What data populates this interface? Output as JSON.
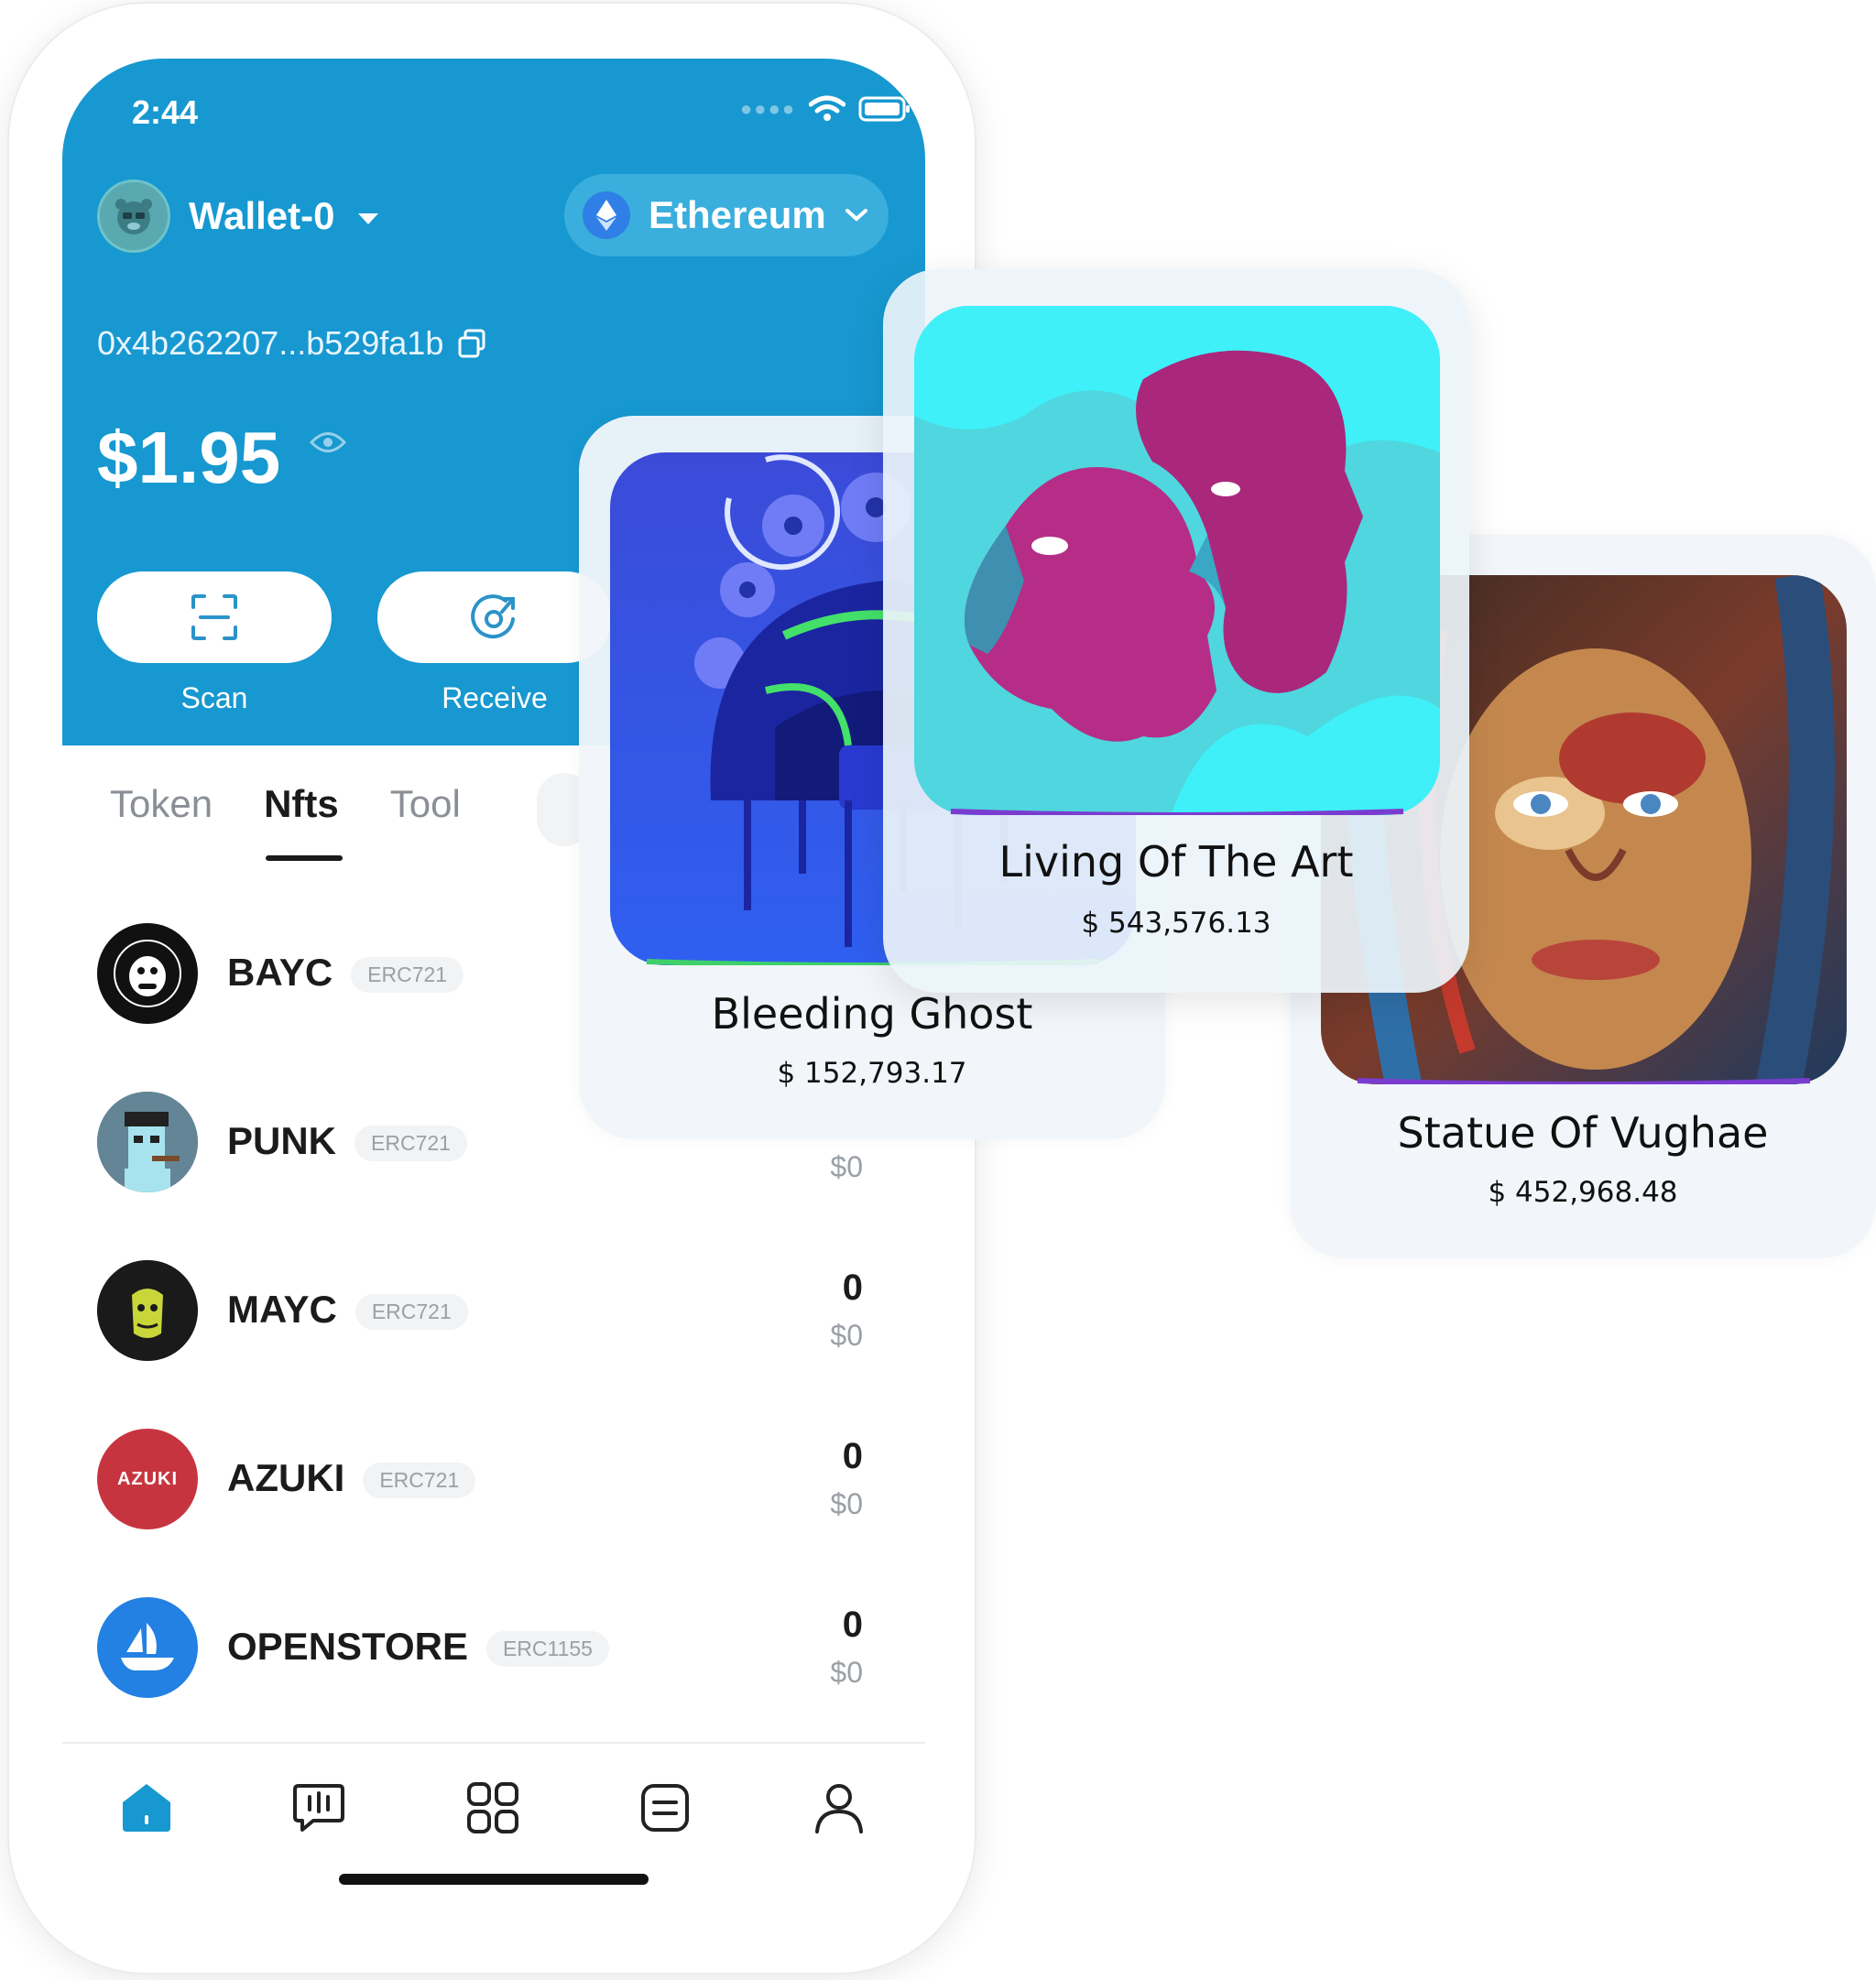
{
  "status": {
    "time": "2:44"
  },
  "wallet": {
    "name": "Wallet-0",
    "network": "Ethereum",
    "address": "0x4b262207...b529fa1b",
    "balance": "$1.95"
  },
  "actions": [
    {
      "label": "Scan"
    },
    {
      "label": "Receive"
    }
  ],
  "tabs": [
    {
      "label": "Token"
    },
    {
      "label": "Nfts"
    },
    {
      "label": "Tool"
    }
  ],
  "nfts": [
    {
      "name": "BAYC",
      "standard": "ERC721",
      "count": "",
      "value": ""
    },
    {
      "name": "PUNK",
      "standard": "ERC721",
      "count": "",
      "value": "$0"
    },
    {
      "name": "MAYC",
      "standard": "ERC721",
      "count": "0",
      "value": "$0"
    },
    {
      "name": "AZUKI",
      "standard": "ERC721",
      "count": "0",
      "value": "$0",
      "logo_text": "AZUKI"
    },
    {
      "name": "OPENSTORE",
      "standard": "ERC1155",
      "count": "0",
      "value": "$0"
    }
  ],
  "bottom_nav": [
    "home-icon",
    "chat-icon",
    "apps-icon",
    "list-icon",
    "profile-icon"
  ],
  "cards": [
    {
      "title": "Bleeding Ghost",
      "price": "$ 152,793.17"
    },
    {
      "title": "Living Of The Art",
      "price": "$ 543,576.13"
    },
    {
      "title": "Statue Of Vughae",
      "price": "$ 452,968.48"
    }
  ],
  "colors": {
    "header": "#1798d0",
    "accent_home": "#1798d0",
    "card_bg": "#f1f6fa"
  }
}
